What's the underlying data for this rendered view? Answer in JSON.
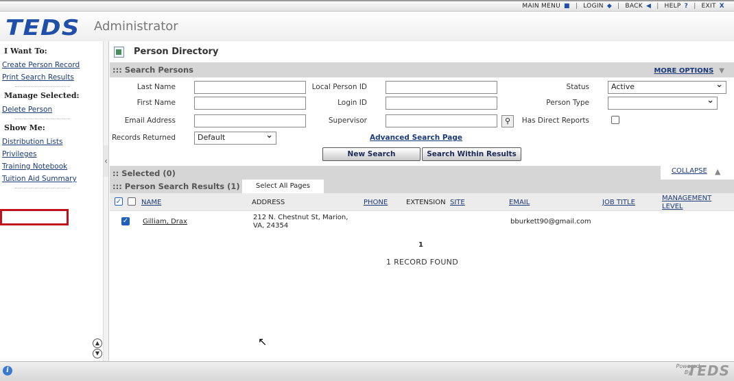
{
  "topnav": {
    "items": [
      {
        "label": "MAIN MENU",
        "icon": "square-icon",
        "glyph": "■"
      },
      {
        "label": "LOGIN",
        "icon": "diamond-icon",
        "glyph": "◆"
      },
      {
        "label": "BACK",
        "icon": "back-arrow-icon",
        "glyph": "◀"
      },
      {
        "label": "HELP",
        "icon": "question-icon",
        "glyph": "?"
      },
      {
        "label": "EXIT",
        "icon": "close-icon",
        "glyph": "X"
      }
    ]
  },
  "header": {
    "logo": "TEDS",
    "subtitle": "Administrator"
  },
  "sidebar": {
    "i_want_to": {
      "heading": "I Want To:",
      "links": [
        "Create Person Record",
        "Print Search Results"
      ]
    },
    "manage_selected": {
      "heading": "Manage Selected:",
      "links": [
        "Delete Person"
      ]
    },
    "show_me": {
      "heading": "Show Me:",
      "links": [
        "Distribution Lists",
        "Privileges",
        "Training Notebook",
        "Tuition Aid Summary"
      ]
    }
  },
  "page": {
    "title": "Person Directory"
  },
  "search": {
    "band_title": "::: Search Persons",
    "more_options": "MORE OPTIONS",
    "labels": {
      "last_name": "Last Name",
      "local_person_id": "Local Person ID",
      "status": "Status",
      "first_name": "First Name",
      "login_id": "Login ID",
      "person_type": "Person Type",
      "email": "Email Address",
      "supervisor": "Supervisor",
      "has_direct_reports": "Has Direct Reports",
      "records_returned": "Records Returned"
    },
    "values": {
      "status": "Active",
      "person_type": "",
      "records_returned": "Default"
    },
    "advanced_link": "Advanced Search Page",
    "new_search": "New Search",
    "search_within": "Search Within Results"
  },
  "selected": {
    "title": ":: Selected (0)",
    "collapse": "COLLAPSE"
  },
  "results": {
    "title": "::: Person Search Results (1)",
    "select_all": "Select All Pages",
    "columns": {
      "name": "NAME",
      "address": "ADDRESS",
      "phone": "PHONE",
      "extension": "EXTENSION",
      "site": "SITE",
      "email": "EMAIL",
      "job_title": "JOB TITLE",
      "management_level": "MANAGEMENT LEVEL"
    },
    "rows": [
      {
        "name": "Gilliam, Drax",
        "address": "212 N. Chestnut St, Marion, VA, 24354",
        "phone": "",
        "extension": "",
        "site": "",
        "email": "bburkett90@gmail.com",
        "job_title": "",
        "management_level": "",
        "checked": true
      }
    ],
    "page_number": "1",
    "records_found": "1  RECORD FOUND"
  },
  "footer": {
    "powered": "Powered",
    "by": "By",
    "logo": "TEDS"
  }
}
